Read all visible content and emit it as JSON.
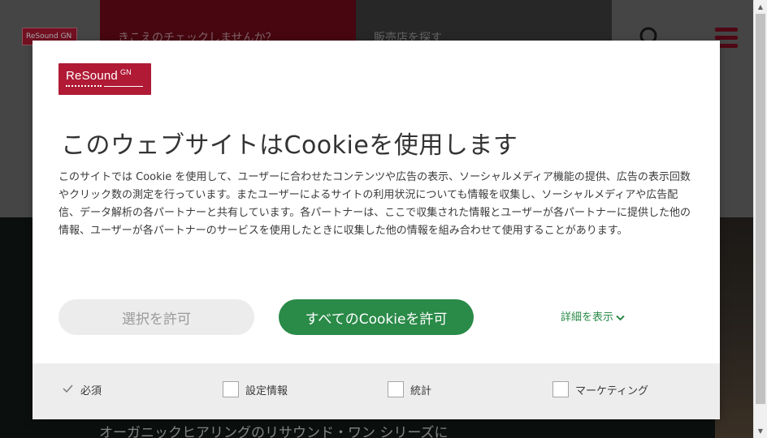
{
  "site": {
    "logo_text": "ReSound GN",
    "nav": [
      {
        "label": "きこえのチェックしませんか？"
      },
      {
        "label": "販売店を探す"
      }
    ],
    "hero_text": "オーガニックヒアリングのリサウンド・ワン シリーズに",
    "icons": {
      "search": "search-icon",
      "menu": "hamburger-menu-icon"
    },
    "colors": {
      "header_gray": "#6b6b6b",
      "brand_dark": "#6e0a1a",
      "store_dark": "#3d3d3d"
    }
  },
  "modal": {
    "logo_text": "ReSound",
    "logo_sup": "GN",
    "title": "このウェブサイトはCookieを使用します",
    "body": "このサイトでは Cookie を使用して、ユーザーに合わせたコンテンツや広告の表示、ソーシャルメディア機能の提供、広告の表示回数やクリック数の測定を行っています。またユーザーによるサイトの利用状況についても情報を収集し、ソーシャルメディアや広告配信、データ解析の各パートナーと共有しています。各パートナーは、ここで収集された情報とユーザーが各パートナーに提供した他の情報、ユーザーが各パートナーのサービスを使用したときに収集した他の情報を組み合わせて使用することがあります。",
    "buttons": {
      "allow_selected": "選択を許可",
      "allow_all": "すべてのCookieを許可",
      "show_details": "詳細を表示"
    },
    "options": [
      {
        "label": "必須",
        "checked": true,
        "locked": true
      },
      {
        "label": "設定情報",
        "checked": false
      },
      {
        "label": "統計",
        "checked": false
      },
      {
        "label": "マーケティング",
        "checked": false
      }
    ],
    "colors": {
      "brand": "#b01a35",
      "accent_green": "#2a8a48",
      "footer_bg": "#ededed"
    }
  }
}
